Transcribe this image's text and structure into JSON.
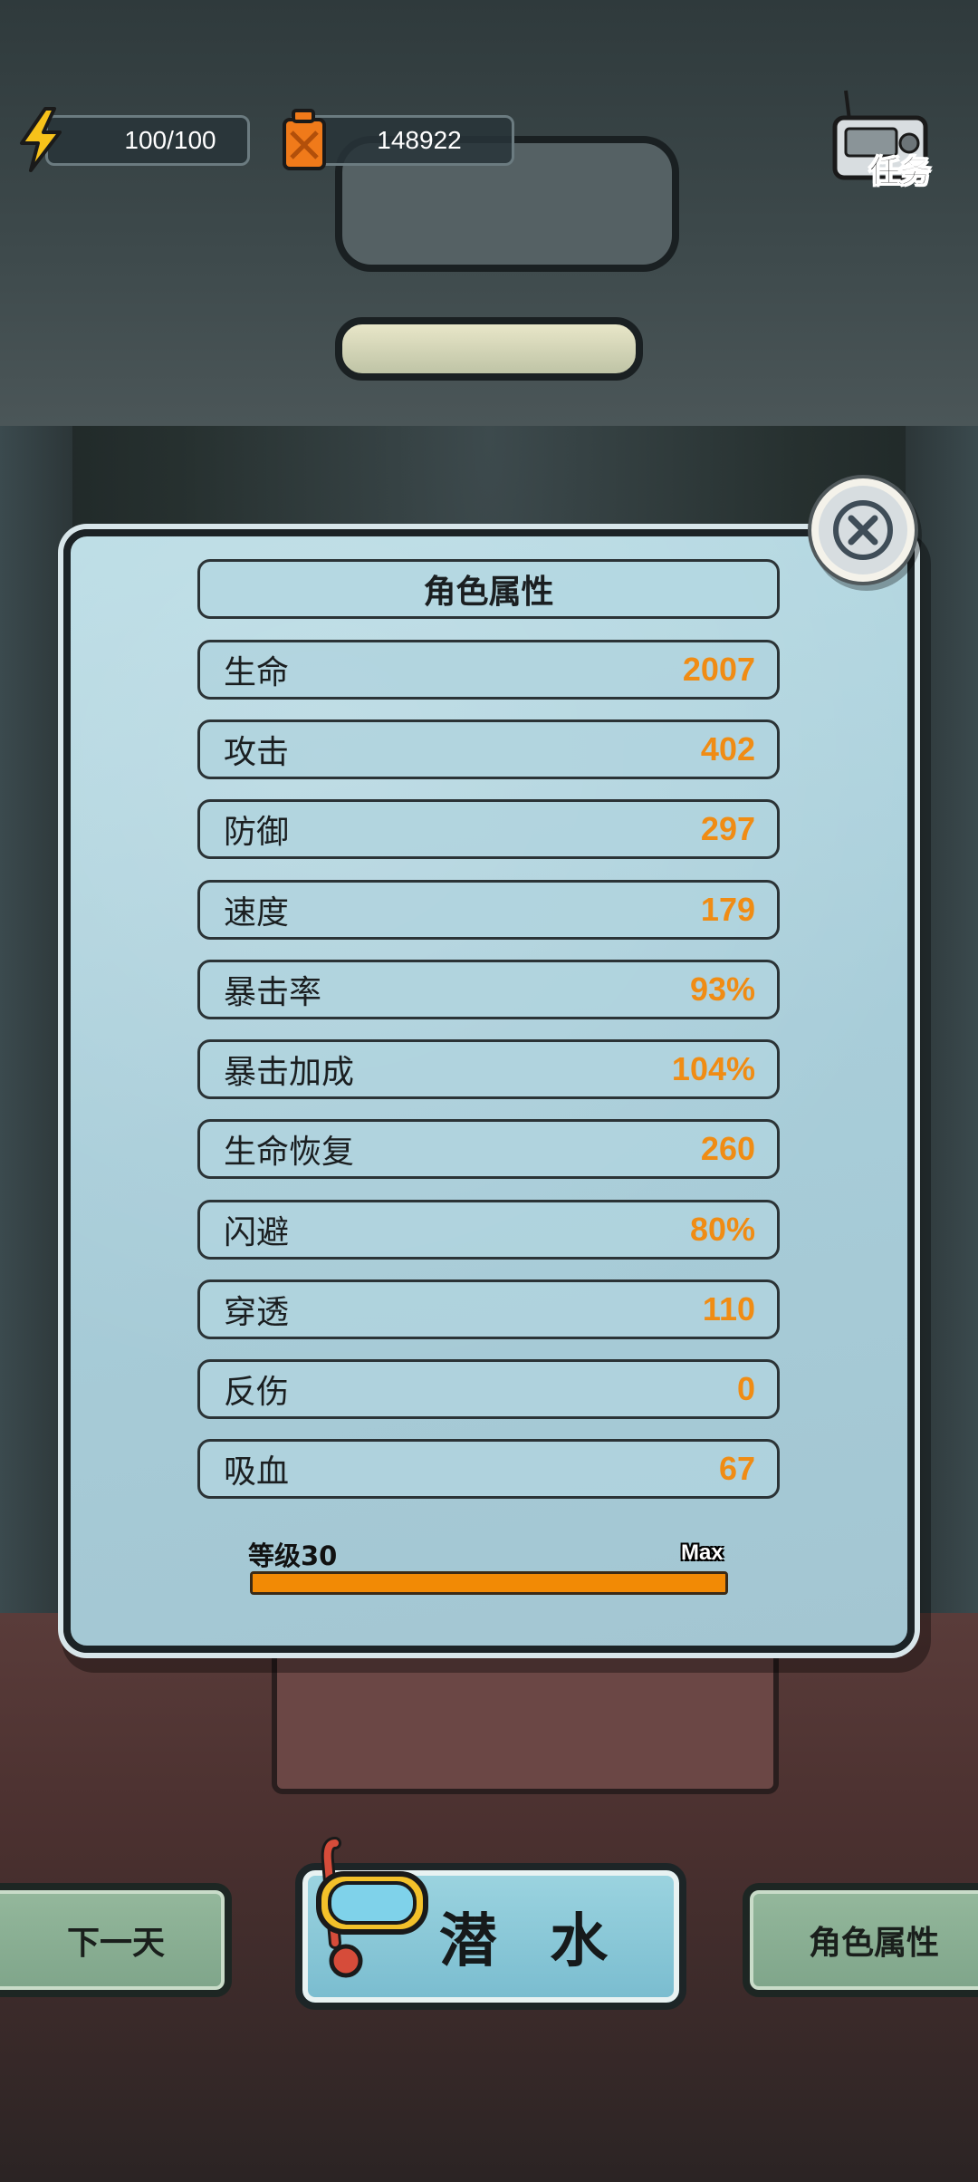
{
  "resources": {
    "energy": "100/100",
    "fuel": "148922"
  },
  "mission_button": {
    "label": "任务"
  },
  "panel": {
    "title": "角色属性",
    "stats": [
      {
        "label": "生命",
        "value": "2007"
      },
      {
        "label": "攻击",
        "value": "402"
      },
      {
        "label": "防御",
        "value": "297"
      },
      {
        "label": "速度",
        "value": "179"
      },
      {
        "label": "暴击率",
        "value": "93%"
      },
      {
        "label": "暴击加成",
        "value": "104%"
      },
      {
        "label": "生命恢复",
        "value": "260"
      },
      {
        "label": "闪避",
        "value": "80%"
      },
      {
        "label": "穿透",
        "value": "110"
      },
      {
        "label": "反伤",
        "value": "0"
      },
      {
        "label": "吸血",
        "value": "67"
      }
    ],
    "level": {
      "label": "等级30",
      "max_label": "Max",
      "progress_fraction": 1.0
    }
  },
  "bottom_bar": {
    "next_day": "下一天",
    "dive": "潜 水",
    "attributes": "角色属性"
  },
  "colors": {
    "stat_value": "#f08c14",
    "level_bar": "#f28a05",
    "panel_bg": "#a8cdd9",
    "side_button": "#8fb597",
    "dive_button": "#8ccbd8"
  }
}
